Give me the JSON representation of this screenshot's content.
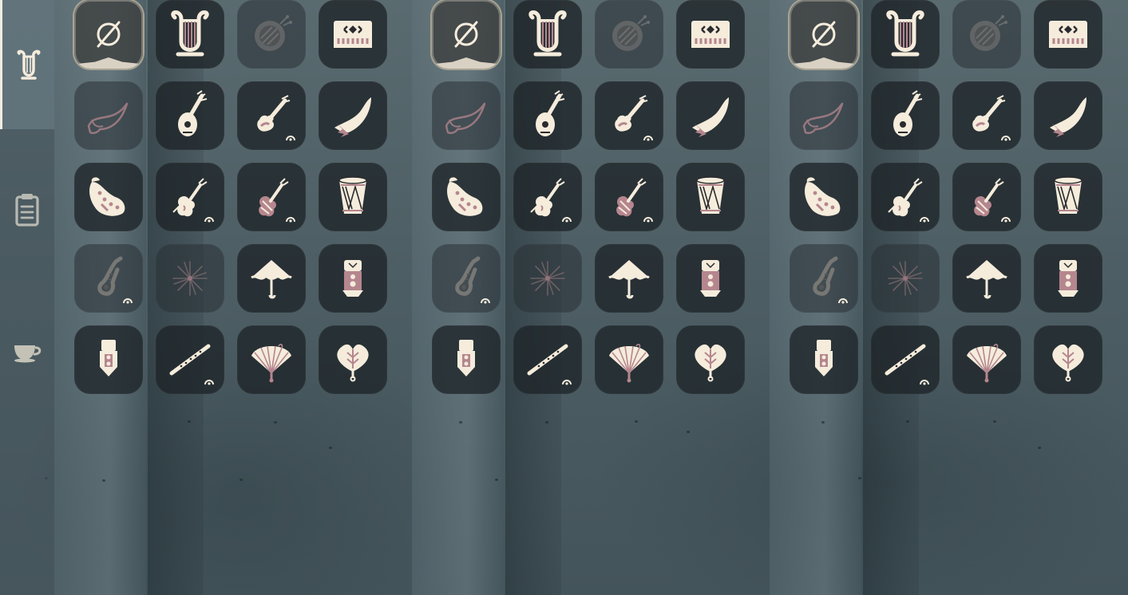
{
  "sidebar": {
    "tabs": [
      {
        "id": "instruments",
        "icon": "harp-icon",
        "active": true
      },
      {
        "id": "songs",
        "icon": "clipboard-icon",
        "active": false
      },
      {
        "id": "other",
        "icon": "teacup-icon",
        "active": false
      }
    ]
  },
  "palette": {
    "cream": "#f5ecdc",
    "rose": "#b5868e",
    "dark": "#2a2b2e",
    "slot": "#1e2428",
    "selected_outline": "#a9a494",
    "sidebar_active_bar": "#f1ece4"
  },
  "panels": [
    {
      "id": "panel-1",
      "instruments": [
        {
          "name": "none-icon",
          "selected": true,
          "dim": false,
          "badge": false
        },
        {
          "name": "harp-icon",
          "selected": false,
          "dim": false,
          "badge": false
        },
        {
          "name": "handpan-icon",
          "selected": false,
          "dim": true,
          "badge": false
        },
        {
          "name": "piano-icon",
          "selected": false,
          "dim": false,
          "badge": false
        },
        {
          "name": "horn-icon",
          "selected": false,
          "dim": true,
          "badge": false
        },
        {
          "name": "lute-icon",
          "selected": false,
          "dim": false,
          "badge": false
        },
        {
          "name": "guitar-icon",
          "selected": false,
          "dim": false,
          "badge": true
        },
        {
          "name": "feather-horn-icon",
          "selected": false,
          "dim": false,
          "badge": false
        },
        {
          "name": "ocarina-icon",
          "selected": false,
          "dim": false,
          "badge": false
        },
        {
          "name": "violin-icon",
          "selected": false,
          "dim": false,
          "badge": true
        },
        {
          "name": "cello-icon",
          "selected": false,
          "dim": false,
          "badge": true
        },
        {
          "name": "drum-icon",
          "selected": false,
          "dim": false,
          "badge": false
        },
        {
          "name": "saxophone-icon",
          "selected": false,
          "dim": true,
          "badge": true
        },
        {
          "name": "fireworks-icon",
          "selected": false,
          "dim": true,
          "badge": false
        },
        {
          "name": "umbrella-icon",
          "selected": false,
          "dim": false,
          "badge": false
        },
        {
          "name": "lantern-icon",
          "selected": false,
          "dim": false,
          "badge": false
        },
        {
          "name": "bell-icon",
          "selected": false,
          "dim": false,
          "badge": false
        },
        {
          "name": "flute-icon",
          "selected": false,
          "dim": false,
          "badge": true
        },
        {
          "name": "fan-icon",
          "selected": false,
          "dim": false,
          "badge": false
        },
        {
          "name": "leaf-fan-icon",
          "selected": false,
          "dim": false,
          "badge": false
        }
      ]
    },
    {
      "id": "panel-2",
      "instruments": [
        {
          "name": "none-icon",
          "selected": true,
          "dim": false,
          "badge": false
        },
        {
          "name": "harp-icon",
          "selected": false,
          "dim": false,
          "badge": false
        },
        {
          "name": "handpan-icon",
          "selected": false,
          "dim": true,
          "badge": false
        },
        {
          "name": "piano-icon",
          "selected": false,
          "dim": false,
          "badge": false
        },
        {
          "name": "horn-icon",
          "selected": false,
          "dim": true,
          "badge": false
        },
        {
          "name": "lute-icon",
          "selected": false,
          "dim": false,
          "badge": false
        },
        {
          "name": "guitar-icon",
          "selected": false,
          "dim": false,
          "badge": true
        },
        {
          "name": "feather-horn-icon",
          "selected": false,
          "dim": false,
          "badge": false
        },
        {
          "name": "ocarina-icon",
          "selected": false,
          "dim": false,
          "badge": false
        },
        {
          "name": "violin-icon",
          "selected": false,
          "dim": false,
          "badge": true
        },
        {
          "name": "cello-icon",
          "selected": false,
          "dim": false,
          "badge": true
        },
        {
          "name": "drum-icon",
          "selected": false,
          "dim": false,
          "badge": false
        },
        {
          "name": "saxophone-icon",
          "selected": false,
          "dim": true,
          "badge": true
        },
        {
          "name": "fireworks-icon",
          "selected": false,
          "dim": true,
          "badge": false
        },
        {
          "name": "umbrella-icon",
          "selected": false,
          "dim": false,
          "badge": false
        },
        {
          "name": "lantern-icon",
          "selected": false,
          "dim": false,
          "badge": false
        },
        {
          "name": "bell-icon",
          "selected": false,
          "dim": false,
          "badge": false
        },
        {
          "name": "flute-icon",
          "selected": false,
          "dim": false,
          "badge": true
        },
        {
          "name": "fan-icon",
          "selected": false,
          "dim": false,
          "badge": false
        },
        {
          "name": "leaf-fan-icon",
          "selected": false,
          "dim": false,
          "badge": false
        }
      ]
    },
    {
      "id": "panel-3",
      "instruments": [
        {
          "name": "none-icon",
          "selected": true,
          "dim": false,
          "badge": false
        },
        {
          "name": "harp-icon",
          "selected": false,
          "dim": false,
          "badge": false
        },
        {
          "name": "handpan-icon",
          "selected": false,
          "dim": true,
          "badge": false
        },
        {
          "name": "piano-icon",
          "selected": false,
          "dim": false,
          "badge": false
        },
        {
          "name": "horn-icon",
          "selected": false,
          "dim": true,
          "badge": false
        },
        {
          "name": "lute-icon",
          "selected": false,
          "dim": false,
          "badge": false
        },
        {
          "name": "guitar-icon",
          "selected": false,
          "dim": false,
          "badge": true
        },
        {
          "name": "feather-horn-icon",
          "selected": false,
          "dim": false,
          "badge": false
        },
        {
          "name": "ocarina-icon",
          "selected": false,
          "dim": false,
          "badge": false
        },
        {
          "name": "violin-icon",
          "selected": false,
          "dim": false,
          "badge": true
        },
        {
          "name": "cello-icon",
          "selected": false,
          "dim": false,
          "badge": true
        },
        {
          "name": "drum-icon",
          "selected": false,
          "dim": false,
          "badge": false
        },
        {
          "name": "saxophone-icon",
          "selected": false,
          "dim": true,
          "badge": true
        },
        {
          "name": "fireworks-icon",
          "selected": false,
          "dim": true,
          "badge": false
        },
        {
          "name": "umbrella-icon",
          "selected": false,
          "dim": false,
          "badge": false
        },
        {
          "name": "lantern-icon",
          "selected": false,
          "dim": false,
          "badge": false
        },
        {
          "name": "bell-icon",
          "selected": false,
          "dim": false,
          "badge": false
        },
        {
          "name": "flute-icon",
          "selected": false,
          "dim": false,
          "badge": true
        },
        {
          "name": "fan-icon",
          "selected": false,
          "dim": false,
          "badge": false
        },
        {
          "name": "leaf-fan-icon",
          "selected": false,
          "dim": false,
          "badge": false
        }
      ]
    }
  ]
}
